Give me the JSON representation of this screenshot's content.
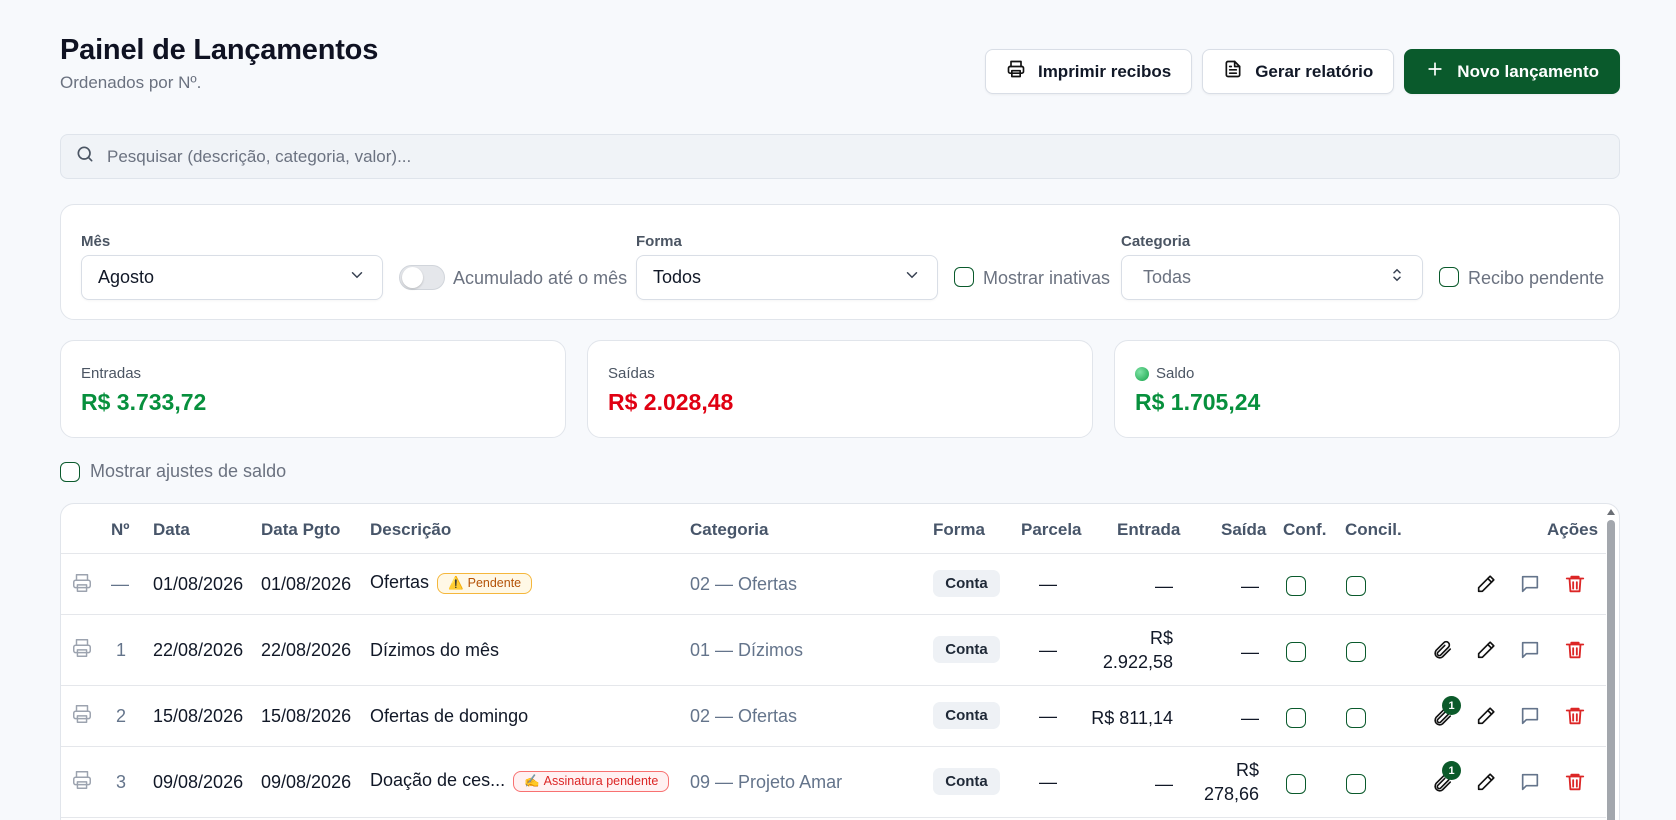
{
  "header": {
    "title": "Painel de Lançamentos",
    "subtitle": "Ordenados por Nº."
  },
  "actions": {
    "print_receipts": "Imprimir recibos",
    "generate_report": "Gerar relatório",
    "new_entry": "Novo lançamento"
  },
  "search": {
    "placeholder": "Pesquisar (descrição, categoria, valor)..."
  },
  "filters": {
    "month_label": "Mês",
    "month_value": "Agosto",
    "cumulative_label": "Acumulado até o mês",
    "form_label": "Forma",
    "form_value": "Todos",
    "show_inactive_label": "Mostrar inativas",
    "category_label": "Categoria",
    "category_value": "Todas",
    "receipt_pending_label": "Recibo pendente"
  },
  "summary": {
    "income_label": "Entradas",
    "income_value": "R$ 3.733,72",
    "expense_label": "Saídas",
    "expense_value": "R$ 2.028,48",
    "balance_label": "Saldo",
    "balance_value": "R$ 1.705,24"
  },
  "show_adjustments_label": "Mostrar ajustes de saldo",
  "table": {
    "headers": {
      "num": "Nº",
      "date": "Data",
      "pay_date": "Data Pgto",
      "description": "Descrição",
      "category": "Categoria",
      "form": "Forma",
      "installment": "Parcela",
      "income": "Entrada",
      "expense": "Saída",
      "confirmed": "Conf.",
      "reconciled": "Concil.",
      "actions": "Ações"
    },
    "rows": [
      {
        "num": "—",
        "date": "01/08/2026",
        "pay_date": "01/08/2026",
        "description": "Ofertas",
        "badge": "Pendente",
        "badge_icon": "⚠️",
        "category": "02 — Ofertas",
        "form": "Conta",
        "installment": "—",
        "income_line1": "—",
        "income_line2": "",
        "expense_line1": "—",
        "expense_line2": ""
      },
      {
        "num": "1",
        "date": "22/08/2026",
        "pay_date": "22/08/2026",
        "description": "Dízimos do mês",
        "category": "01 — Dízimos",
        "form": "Conta",
        "installment": "—",
        "income_line1": "R$",
        "income_line2": "2.922,58",
        "expense_line1": "—",
        "expense_line2": ""
      },
      {
        "num": "2",
        "date": "15/08/2026",
        "pay_date": "15/08/2026",
        "description": "Ofertas de domingo",
        "category": "02 — Ofertas",
        "form": "Conta",
        "installment": "—",
        "income_line1": "R$ 811,14",
        "income_line2": "",
        "expense_line1": "—",
        "expense_line2": "",
        "attachments": "1"
      },
      {
        "num": "3",
        "date": "09/08/2026",
        "pay_date": "09/08/2026",
        "description": "Doação de ces...",
        "badge": "Assinatura pendente",
        "badge_icon": "✍️",
        "category": "09 — Projeto Amar",
        "form": "Conta",
        "installment": "—",
        "income_line1": "—",
        "income_line2": "",
        "expense_line1": "R$",
        "expense_line2": "278,66",
        "attachments": "1"
      }
    ]
  },
  "colors": {
    "primary": "#0a5a2c",
    "income": "#07903d",
    "expense": "#e00012"
  },
  "icons": [
    "printer-icon",
    "file-icon",
    "plus-icon",
    "search-icon",
    "chevron-down-icon",
    "chevron-updown-icon",
    "paperclip-icon",
    "pencil-icon",
    "comment-icon",
    "trash-icon"
  ]
}
